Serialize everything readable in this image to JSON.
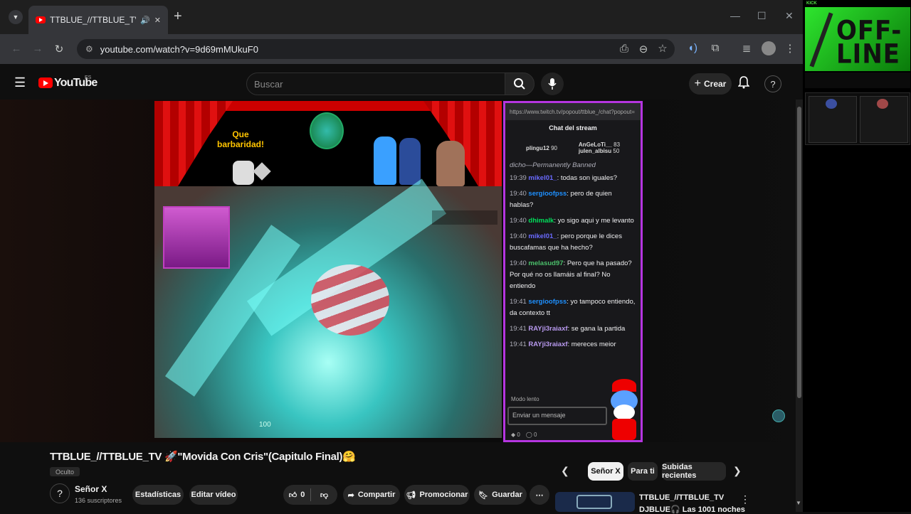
{
  "browser": {
    "tab_title": "TTBLUE_//TTBLUE_TV 🚀\"M",
    "url": "youtube.com/watch?v=9d69mMUkuF0",
    "new_tab": "+",
    "minimize": "—",
    "maximize": "☐",
    "close": "✕"
  },
  "youtube": {
    "logo": "YouTube",
    "region": "ES",
    "search_placeholder": "Buscar",
    "create_label": "Crear"
  },
  "video_overlay": {
    "banner_text_line1": "Que",
    "banner_text_line2": "barbaridad!",
    "ammo": "100"
  },
  "chat": {
    "url": "https://www.twitch.tv/popout/ttblue_/chat?popout=",
    "header": "Chat del stream",
    "gifters": [
      {
        "name": "plingu12",
        "count": "90"
      },
      {
        "name": "AnGeLoTi__",
        "count": "83"
      },
      {
        "name": "julen_albisu",
        "count": "50"
      }
    ],
    "banned_line": "dicho—Permanently Banned",
    "messages": [
      {
        "time": "19:39",
        "user": "mikel01_",
        "text": ": todas son iguales?",
        "cls": "u1"
      },
      {
        "time": "19:40",
        "user": "sergioofpss",
        "text": ": pero de quien hablas?",
        "cls": "u2"
      },
      {
        "time": "19:40",
        "user": "dhimalk",
        "text": ": yo sigo aqui y me levanto",
        "cls": "u3"
      },
      {
        "time": "19:40",
        "user": "mikel01_",
        "text": ": pero porque le dices buscafamas que ha hecho?",
        "cls": "u1"
      },
      {
        "time": "19:40",
        "user": "melasud97",
        "text": ": Pero que ha pasado? Por qué no os llamáis al final? No entiendo",
        "cls": "u5"
      },
      {
        "time": "19:41",
        "user": "sergioofpss",
        "text": ": yo tampoco entiendo, da contexto tt",
        "cls": "u2"
      },
      {
        "time": "19:41",
        "user": "RAYji3raiaxf",
        "text": ": se gana la partida",
        "cls": "u4"
      },
      {
        "time": "19:41",
        "user": "RAYji3raiaxf",
        "text": ": mereces meior",
        "cls": "u4"
      }
    ],
    "slow_mode": "Modo lento",
    "input_placeholder": "Enviar un mensaje",
    "points": "0",
    "bits": "0"
  },
  "video_info": {
    "title": "TTBLUE_//TTBLUE_TV 🚀\"Movida Con Cris\"(Capitulo Final)🤗",
    "visibility": "Oculto",
    "channel": "Señor X",
    "subscribers": "136 suscriptores",
    "stats_button": "Estadísticas",
    "edit_button": "Editar vídeo",
    "likes": "0",
    "share": "Compartir",
    "promote": "Promocionar",
    "save": "Guardar"
  },
  "filter_chips": [
    "Señor X",
    "Para ti",
    "Subidas recientes"
  ],
  "recommendation": {
    "channel": "TTBLUE_//TTBLUE_TV",
    "title": "DJBLUE🎧 Las 1001 noches"
  },
  "overlay": {
    "kick_label": "KICK",
    "offline_text_1": "OFF-",
    "offline_text_2": "LINE"
  },
  "colors": {
    "accent_red": "#ff0000",
    "chat_border": "#b535e0",
    "kick_green": "#54e346"
  }
}
